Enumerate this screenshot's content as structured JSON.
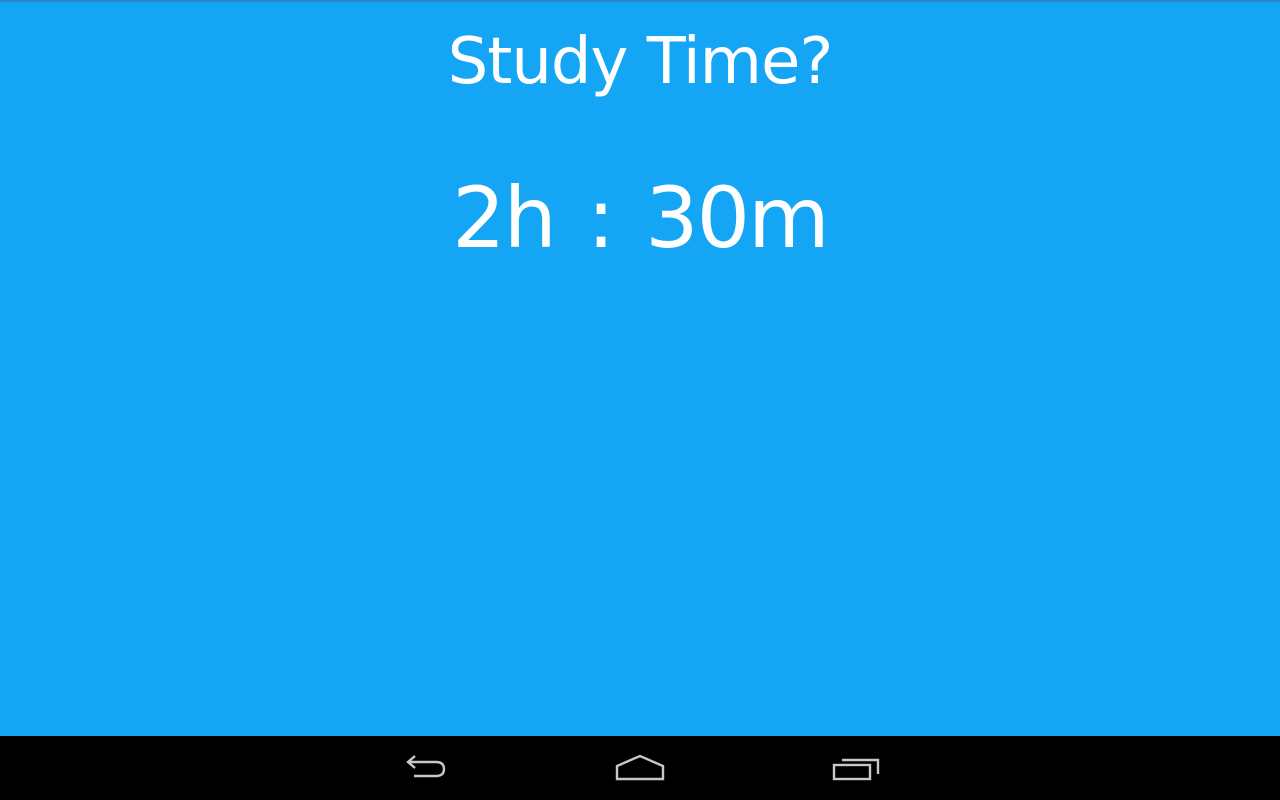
{
  "screen": {
    "title": "Study Time?",
    "hours": "2h",
    "separator": ":",
    "minutes": "30m",
    "background_color": "#14a5f5",
    "text_color": "#ffffff"
  },
  "navbar": {
    "background_color": "#000000",
    "buttons": [
      {
        "icon": "back-icon"
      },
      {
        "icon": "home-icon"
      },
      {
        "icon": "recent-apps-icon"
      }
    ]
  }
}
